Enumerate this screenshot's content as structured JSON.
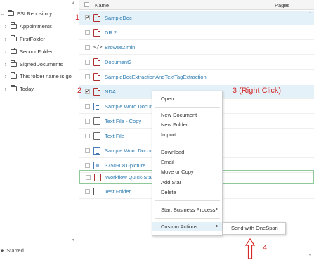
{
  "sidebar": {
    "root": "ESLRepository",
    "items": [
      {
        "label": "Appointments"
      },
      {
        "label": "FirstFolder"
      },
      {
        "label": "SecondFolder"
      },
      {
        "label": "SignedDocuments"
      },
      {
        "label": "This folder name is go"
      },
      {
        "label": "Today"
      }
    ],
    "starred": "Starred"
  },
  "list": {
    "header_name": "Name",
    "header_pages": "Pages",
    "rows": [
      {
        "name": "SampleDoc",
        "icon": "pdf-file-icon",
        "checked": true
      },
      {
        "name": "DR 2",
        "icon": "pdf-file-icon",
        "checked": false
      },
      {
        "name": "Browse2.min",
        "icon": "code-file-icon",
        "checked": false
      },
      {
        "name": "Document2",
        "icon": "pdf-file-icon",
        "checked": false
      },
      {
        "name": "SampleDocExtractionAndTextTagExtraction",
        "icon": "pdf-file-icon",
        "checked": false
      },
      {
        "name": "NDA",
        "icon": "pdf-file-icon",
        "checked": true
      },
      {
        "name": "Sample Word Docum",
        "icon": "word-file-icon",
        "checked": false
      },
      {
        "name": "Text File - Copy",
        "icon": "text-file-icon",
        "checked": false
      },
      {
        "name": "Text File",
        "icon": "text-file-icon",
        "checked": false
      },
      {
        "name": "Sample Word Docum",
        "icon": "word-file-icon",
        "checked": false
      },
      {
        "name": "37509081-picture",
        "icon": "image-file-icon",
        "checked": false
      },
      {
        "name": "Workflow Quick-Sta",
        "icon": "workflow-file-icon",
        "checked": false
      },
      {
        "name": "Test Folder",
        "icon": "folder-icon",
        "checked": false
      }
    ]
  },
  "context_menu": {
    "open": "Open",
    "new_document": "New Document",
    "new_folder": "New Folder",
    "import": "Import",
    "download": "Download",
    "email": "Email",
    "move_or_copy": "Move or Copy",
    "add_star": "Add Star",
    "delete": "Delete",
    "start_business_process": "Start Business Process",
    "custom_actions": "Custom Actions"
  },
  "submenu": {
    "send_with_onespan": "Send with OneSpan"
  },
  "annotations": {
    "a1": "1",
    "a2": "2",
    "a3": "3 (Right Click)",
    "a4": "4"
  },
  "colors": {
    "link": "#2a7ab0",
    "selected_row": "#e4f1f8",
    "annotation": "#d42a2a"
  }
}
